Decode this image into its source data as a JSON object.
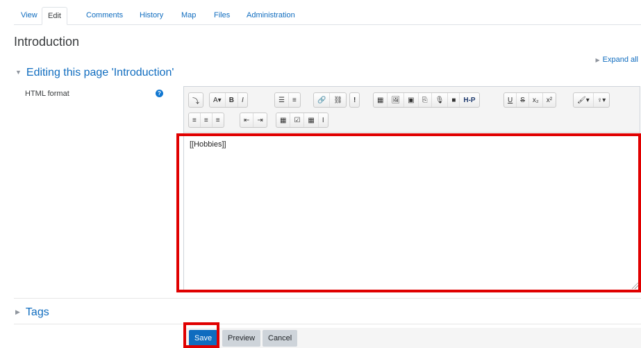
{
  "tabs": [
    {
      "label": "View",
      "active": false
    },
    {
      "label": "Edit",
      "active": true
    },
    {
      "label": "Comments",
      "active": false
    },
    {
      "label": "History",
      "active": false
    },
    {
      "label": "Map",
      "active": false
    },
    {
      "label": "Files",
      "active": false
    },
    {
      "label": "Administration",
      "active": false
    }
  ],
  "page": {
    "title": "Introduction",
    "expand_all": "Expand all",
    "section_title": "Editing this page 'Introduction'",
    "field_label": "HTML format",
    "help_icon": "?"
  },
  "editor": {
    "content": "[[Hobbies]]",
    "toolbar_row1": [
      "⤵",
      "A▾",
      "B",
      "I",
      "☰",
      "≡",
      "🔗",
      "⛓",
      "!",
      "▦",
      "🖼",
      "▣",
      "⎘",
      "🎙",
      "■",
      "H-P",
      "U",
      "S",
      "x₂",
      "x²",
      "🖌▾",
      "♀▾"
    ],
    "toolbar_row2": [
      "≡",
      "≡",
      "≡",
      "⇤",
      "⇥",
      "▦",
      "☑",
      "▦",
      "I"
    ]
  },
  "tags": {
    "label": "Tags"
  },
  "buttons": {
    "save": "Save",
    "preview": "Preview",
    "cancel": "Cancel"
  },
  "colors": {
    "link": "#0f6cbf",
    "primary_button": "#0f6cbf",
    "highlight": "#e00000"
  }
}
